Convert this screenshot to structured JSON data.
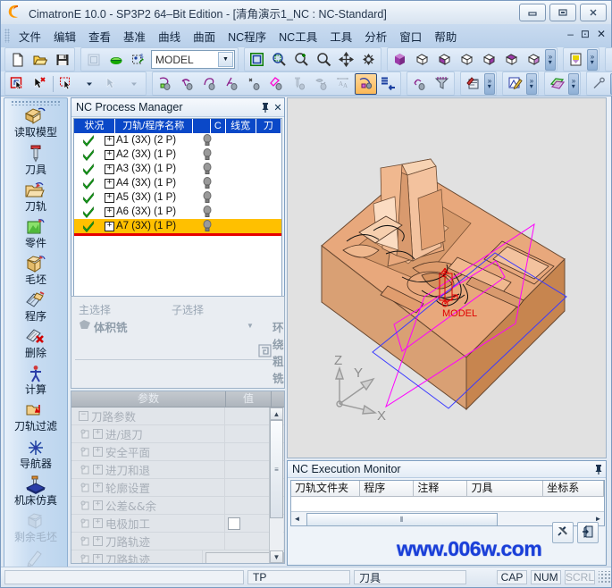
{
  "window": {
    "title": "CimatronE 10.0 - SP3P2 64–Bit Edition - [清角演示1_NC : NC-Standard]",
    "minimize": "—",
    "maximize": "❐",
    "close": "✕"
  },
  "menubar": {
    "items": [
      "文件",
      "编辑",
      "查看",
      "基准",
      "曲线",
      "曲面",
      "NC程序",
      "NC工具",
      "工具",
      "分析",
      "窗口",
      "帮助"
    ],
    "mdi": [
      "–",
      "⊡",
      "✕"
    ]
  },
  "toolbar_row1": {
    "groups": [
      {
        "name": "file",
        "buttons": [
          {
            "icon": "new-file-icon",
            "label": "新建"
          },
          {
            "icon": "open-folder-icon",
            "label": "打开"
          },
          {
            "icon": "save-disk-icon",
            "label": "保存"
          }
        ]
      },
      {
        "name": "model",
        "buttons": [
          {
            "icon": "model-window-icon",
            "label": "模型窗口",
            "disabled": true
          },
          {
            "icon": "solid-green-icon",
            "label": "实体"
          },
          {
            "icon": "set-icon",
            "label": "集合"
          }
        ],
        "combo": {
          "value": "MODEL",
          "arrow": "▼"
        }
      },
      {
        "name": "view",
        "buttons": [
          {
            "icon": "fit-screen-icon",
            "label": "全屏显示"
          },
          {
            "icon": "zoom-window-icon",
            "label": "窗口缩放"
          },
          {
            "icon": "zoom-in-icon",
            "label": "放大"
          },
          {
            "icon": "zoom-icon",
            "label": "缩放"
          },
          {
            "icon": "pan-icon",
            "label": "平移"
          },
          {
            "icon": "rotate-icon",
            "label": "旋转"
          }
        ]
      },
      {
        "name": "std-views",
        "buttons": [
          {
            "icon": "iso-view-icon",
            "label": "等轴测视图"
          },
          {
            "icon": "top-view-icon",
            "label": "顶视图"
          },
          {
            "icon": "front-view-icon",
            "label": "前视图"
          },
          {
            "icon": "right-view-icon",
            "label": "右视图"
          },
          {
            "icon": "left-view-icon",
            "label": "左视图"
          },
          {
            "icon": "back-view-icon",
            "label": "后视图"
          },
          {
            "icon": "bottom-view-icon",
            "label": "底视图"
          }
        ]
      },
      {
        "name": "render",
        "buttons": [
          {
            "icon": "shading-icon",
            "label": "着色"
          }
        ]
      },
      {
        "name": "light",
        "buttons": [
          {
            "icon": "lightbulb-icon",
            "label": "光源"
          }
        ]
      }
    ],
    "overflow": "»"
  },
  "toolbar_row2": {
    "groups": [
      {
        "name": "select",
        "buttons": [
          {
            "icon": "select-box-icon",
            "label": "框选"
          },
          {
            "icon": "deselect-icon",
            "label": "取消选择"
          },
          {
            "icon": "select-region-icon",
            "label": "区域选择"
          },
          {
            "icon": "pick-filter-icon",
            "label": "拾取过滤",
            "disabled": true
          }
        ]
      },
      {
        "name": "nc-ops",
        "buttons": [
          {
            "icon": "nc-proc1-icon",
            "label": "工序1"
          },
          {
            "icon": "nc-proc2-icon",
            "label": "工序2"
          },
          {
            "icon": "nc-proc3-icon",
            "label": "工序3"
          },
          {
            "icon": "nc-proc4-icon",
            "label": "工序4"
          },
          {
            "icon": "nc-proc5-icon",
            "label": "工序5"
          },
          {
            "icon": "nc-proc6-icon",
            "label": "工序6"
          },
          {
            "icon": "nc-tool-icon",
            "label": "刀具",
            "disabled": true
          },
          {
            "icon": "nc-post-icon",
            "label": "后置",
            "disabled": true
          },
          {
            "icon": "nc-measure-icon",
            "label": "测量",
            "disabled": true
          },
          {
            "icon": "nc-manager-icon",
            "label": "NC过程管理器",
            "selected": true
          },
          {
            "icon": "nc-list-icon",
            "label": "程序列表"
          }
        ]
      },
      {
        "name": "nc-aux",
        "buttons": [
          {
            "icon": "nc-path-icon",
            "label": "刀轨"
          },
          {
            "icon": "nc-funnel-icon",
            "label": "过滤"
          }
        ]
      },
      {
        "name": "annotate",
        "buttons": [
          {
            "icon": "annotation-icon",
            "label": "标注"
          }
        ]
      },
      {
        "name": "draft",
        "buttons": [
          {
            "icon": "draft-icon",
            "label": "绘图"
          }
        ]
      },
      {
        "name": "surface",
        "buttons": [
          {
            "icon": "surface-icon",
            "label": "曲面"
          }
        ]
      },
      {
        "name": "curve",
        "buttons": [
          {
            "icon": "curve-icon",
            "label": "曲线"
          }
        ]
      },
      {
        "name": "datum",
        "buttons": [
          {
            "icon": "datum-icon",
            "label": "基准"
          }
        ]
      }
    ],
    "overflow": "»"
  },
  "left_toolbar": {
    "items": [
      {
        "icon": "read-model-icon",
        "label": "读取模型",
        "disabled": false
      },
      {
        "icon": "tool-icon",
        "label": "刀具",
        "disabled": false
      },
      {
        "icon": "toolpath-icon",
        "label": "刀轨",
        "disabled": false
      },
      {
        "icon": "part-icon",
        "label": "零件",
        "disabled": false
      },
      {
        "icon": "stock-icon",
        "label": "毛坯",
        "disabled": false
      },
      {
        "icon": "program-icon",
        "label": "程序",
        "disabled": false
      },
      {
        "icon": "delete-icon",
        "label": "删除",
        "disabled": false
      },
      {
        "icon": "calculate-icon",
        "label": "计算",
        "disabled": false
      },
      {
        "icon": "toolpath-filter-icon",
        "label": "刀轨过滤",
        "disabled": false
      },
      {
        "icon": "navigator-icon",
        "label": "导航器",
        "disabled": false
      },
      {
        "icon": "machine-sim-icon",
        "label": "机床仿真",
        "disabled": false
      },
      {
        "icon": "residual-stock-icon",
        "label": "剩余毛坯",
        "disabled": true
      },
      {
        "icon": "toolpath-edit-icon",
        "label": "刀轨编辑",
        "disabled": true
      }
    ],
    "footer_left": "⋮",
    "footer_right": "▮▸"
  },
  "process_manager": {
    "title": "NC Process Manager",
    "pin": "⇱",
    "close": "✕",
    "columns": [
      "状况",
      "刀轨/程序名称",
      "",
      "C",
      "线宽",
      "刀"
    ],
    "rows": [
      {
        "status": "ok",
        "expand": "+",
        "name": "A1 (3X) (2 P)",
        "lamp": "grey",
        "selected": false
      },
      {
        "status": "ok",
        "expand": "+",
        "name": "A2 (3X) (1 P)",
        "lamp": "grey",
        "selected": false
      },
      {
        "status": "ok",
        "expand": "+",
        "name": "A3 (3X) (1 P)",
        "lamp": "grey",
        "selected": false
      },
      {
        "status": "ok",
        "expand": "+",
        "name": "A4 (3X) (1 P)",
        "lamp": "grey",
        "selected": false
      },
      {
        "status": "ok",
        "expand": "+",
        "name": "A5 (3X) (1 P)",
        "lamp": "grey",
        "selected": false
      },
      {
        "status": "ok",
        "expand": "+",
        "name": "A6 (3X) (1 P)",
        "lamp": "grey",
        "selected": false
      },
      {
        "status": "ok",
        "expand": "+",
        "name": "A7 (3X) (1 P)",
        "lamp": "grey",
        "selected": true
      }
    ],
    "scroll_left": "◄",
    "scroll_right": "►",
    "scroll_thumb": "⦀"
  },
  "selection_panel": {
    "main_label": "主选择",
    "main_value": "体积铣",
    "main_arrow": "▼",
    "sub_label": "子选择",
    "sub_value": "环绕粗铣"
  },
  "parameters": {
    "col_param": "参数",
    "col_value": "值",
    "rows": [
      {
        "label": "刀路参数",
        "expand": "−",
        "root": true,
        "value": ""
      },
      {
        "label": "进/退刀",
        "expand": "+",
        "root": false,
        "value": ""
      },
      {
        "label": "安全平面",
        "expand": "+",
        "root": false,
        "value": ""
      },
      {
        "label": "进刀和退",
        "expand": "+",
        "root": false,
        "value": ""
      },
      {
        "label": "轮廓设置",
        "expand": "+",
        "root": false,
        "value": ""
      },
      {
        "label": "公差&&余",
        "expand": "+",
        "root": false,
        "value": ""
      },
      {
        "label": "电极加工",
        "expand": "+",
        "root": false,
        "value": "checkbox"
      },
      {
        "label": "刀路轨迹",
        "expand": "+",
        "root": false,
        "value": ""
      },
      {
        "label": "刀路轨迹",
        "expand": "+",
        "root": false,
        "value": "textfield"
      }
    ],
    "scroll_up": "▲",
    "scroll_down": "▼",
    "scroll_thumb": "≡"
  },
  "viewport": {
    "model_label": "MODEL",
    "axis_z": "Z",
    "axis_y": "Y",
    "axis_x": "X",
    "ucs_z": "Z",
    "ucs_y": "Y",
    "ucs_x": "X",
    "colors": {
      "background": "#e1e1e1",
      "stock": "#e8a87c",
      "stock_light": "#f5c9a3",
      "stock_dark": "#d08f5f",
      "boundary_magenta": "#ff00ff",
      "boundary_blue": "#3333ff",
      "label_red": "#e00000"
    }
  },
  "execution_monitor": {
    "title": "NC Execution Monitor",
    "pin": "⇱",
    "columns": [
      "刀轨文件夹",
      "程序",
      "注释",
      "刀具",
      "坐标系"
    ],
    "scroll_left": "◄",
    "scroll_right": "►",
    "scroll_thumb": "⦀",
    "buttons": [
      {
        "icon": "tool-wrench-icon",
        "name": "post-process-button"
      },
      {
        "icon": "exit-door-icon",
        "name": "exit-button"
      }
    ]
  },
  "watermark": "www.006w.com",
  "status_bar": {
    "left": "",
    "tp": "TP",
    "tool": "刀具",
    "cap": "CAP",
    "num": "NUM",
    "scrl": "SCRL"
  }
}
